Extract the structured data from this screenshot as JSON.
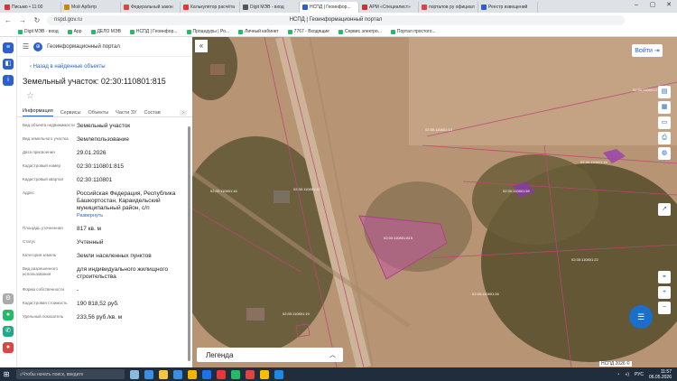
{
  "browser": {
    "tabs": [
      {
        "label": "Письмо • 11:00",
        "color": "#d33"
      },
      {
        "label": "Мой Арбитр",
        "color": "#c80"
      },
      {
        "label": "Федеральный закон",
        "color": "#d44"
      },
      {
        "label": "Калькулятор расчёта",
        "color": "#e33"
      },
      {
        "label": "Digit МЭВ - вход",
        "color": "#555"
      },
      {
        "label": "НСПД | Геоинфор...",
        "color": "#2c5fd0",
        "active": true
      },
      {
        "label": "АРМ «Специалист»",
        "color": "#c33"
      },
      {
        "label": "порталов ру официал",
        "color": "#d44"
      },
      {
        "label": "Реестр извещений",
        "color": "#2c5fd0"
      }
    ],
    "url": "nspd.gov.ru",
    "page_title": "НСПД | Геоинформационный портал",
    "bookmarks": [
      "Digit МЭВ - вход",
      "App",
      "ДЕЛО МЭВ",
      "НСПД | Геоинфор...",
      "Процедуры | Ро...",
      "Личный кабинет",
      "7767 - Входящие",
      "Сервис электро...",
      "Портал простого..."
    ]
  },
  "panel": {
    "portal_title": "Геоинформационный портал",
    "back_label": "Назад в найденные объекты",
    "object_title": "Земельный участок: 02:30:110801:815",
    "tabs": [
      "Информация",
      "Сервисы",
      "Объекты",
      "Части ЗУ",
      "Состав"
    ],
    "rows": [
      {
        "key": "Вид объекта недвижимости",
        "value": "Земельный участок"
      },
      {
        "key": "Вид земельного участка",
        "value": "Землепользование"
      },
      {
        "key": "Дата присвоения",
        "value": "29.01.2026"
      },
      {
        "key": "Кадастровый номер",
        "value": "02:30:110801:815"
      },
      {
        "key": "Кадастровый квартал",
        "value": "02:30:110801"
      },
      {
        "key": "Адрес",
        "value": "Российская Федерация, Республика Башкортостан, Караидельский муниципальный район, с/п",
        "link": "Развернуть"
      },
      {
        "key": "Площадь уточненная",
        "value": "817 кв. м"
      },
      {
        "key": "Статус",
        "value": "Учтенный"
      },
      {
        "key": "Категория земель",
        "value": "Земли населенных пунктов"
      },
      {
        "key": "Вид разрешенного использования",
        "value": "для индивидуального жилищного строительства"
      },
      {
        "key": "Форма собственности",
        "value": "-"
      },
      {
        "key": "Кадастровая стоимость",
        "value": "190 818,52 руб."
      },
      {
        "key": "Удельный показатель",
        "value": "233,56 руб./кв. м"
      }
    ]
  },
  "map": {
    "login_label": "Войти",
    "legend_label": "Легенда",
    "scale_text": "НСПД 2026 ©",
    "parcel_labels": [
      "02:30:110801:815",
      "02:30:110801:16",
      "02:30:110801:12",
      "02:30:110801:13",
      "02:30:110801:39",
      "02:30:110801:18",
      "02:30:110801:2",
      "02:30:110801:22",
      "02:30:110801:26",
      "02:30:110801:19"
    ]
  },
  "taskbar": {
    "search_placeholder": "Чтобы начать поиск, введите",
    "lang": "РУС",
    "time": "11:57",
    "date": "06.05.2026"
  }
}
